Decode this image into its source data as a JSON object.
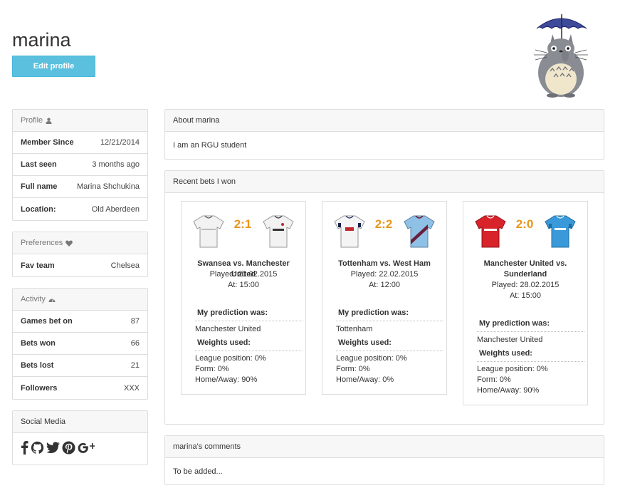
{
  "header": {
    "username": "marina",
    "edit_button": "Edit profile"
  },
  "profile_panel": {
    "title": "Profile",
    "rows": [
      {
        "label": "Member Since",
        "value": "12/21/2014"
      },
      {
        "label": "Last seen",
        "value": "3 months ago"
      },
      {
        "label": "Full name",
        "value": "Marina Shchukina"
      },
      {
        "label": "Location:",
        "value": "Old Aberdeen"
      }
    ]
  },
  "preferences_panel": {
    "title": "Preferences",
    "rows": [
      {
        "label": "Fav team",
        "value": "Chelsea"
      }
    ]
  },
  "activity_panel": {
    "title": "Activity",
    "rows": [
      {
        "label": "Games bet on",
        "value": "87"
      },
      {
        "label": "Bets won",
        "value": "66"
      },
      {
        "label": "Bets lost",
        "value": "21"
      },
      {
        "label": "Followers",
        "value": "XXX"
      }
    ]
  },
  "social_panel": {
    "title": "Social Media",
    "icons": [
      "facebook-icon",
      "github-icon",
      "twitter-icon",
      "pinterest-icon",
      "google-plus-icon"
    ]
  },
  "about_panel": {
    "title": "About marina",
    "text": "I am an RGU student"
  },
  "bets_panel": {
    "title": "Recent bets I won",
    "prediction_label": "My prediction was:",
    "weights_label": "Weights used:",
    "bets": [
      {
        "score": "2:1",
        "title_line1": "Swansea vs. Manchester United",
        "title_line2": "",
        "played": "Played: 21.02.2015",
        "time": "At: 15:00",
        "prediction": "Manchester United",
        "weights": [
          "League position: 0%",
          "Form: 0%",
          "Home/Away: 90%"
        ],
        "home_color": "#f2f2f2",
        "away_color": "#f2f2f2"
      },
      {
        "score": "2:2",
        "title_line1": "Tottenham vs. West Ham",
        "title_line2": "",
        "played": "Played: 22.02.2015",
        "time": "At: 12:00",
        "prediction": "Tottenham",
        "weights": [
          "League position: 0%",
          "Form: 0%",
          "Home/Away: 0%"
        ],
        "home_color": "#f4f4f4",
        "away_color": "#8fc1e6"
      },
      {
        "score": "2:0",
        "title_line1": "Manchester United vs.",
        "title_line2": "Sunderland",
        "played": "Played: 28.02.2015",
        "time": "At: 15:00",
        "prediction": "Manchester United",
        "weights": [
          "League position: 0%",
          "Form: 0%",
          "Home/Away: 90%"
        ],
        "home_color": "#d8232a",
        "away_color": "#3a9ad9"
      }
    ]
  },
  "comments_panel": {
    "title": "marina's comments",
    "text": "To be added..."
  }
}
